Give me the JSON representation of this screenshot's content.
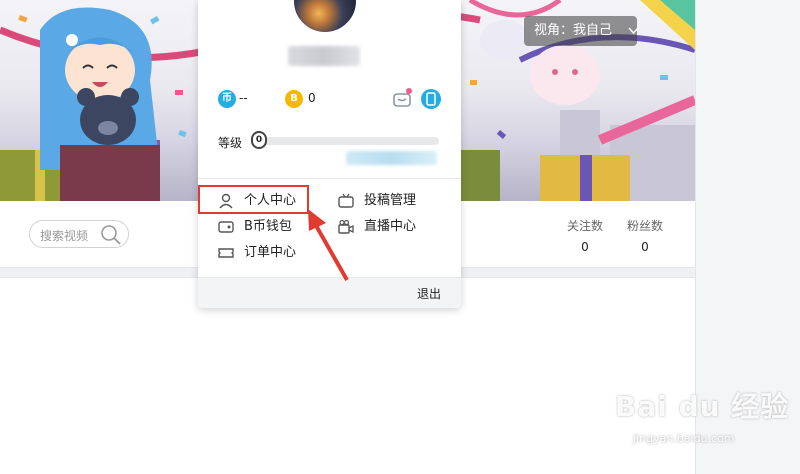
{
  "banner": {
    "view_label": "视角：我自己",
    "view_chevron_icon": "chevron-down-icon"
  },
  "profile": {
    "search_placeholder": "搜索视频",
    "following_label": "关注数",
    "following_count": "0",
    "fans_label": "粉丝数",
    "fans_count": "0"
  },
  "dropdown": {
    "coins_label": "币",
    "coins_value": "--",
    "bcoin_label": "B",
    "bcoin_value": "0",
    "level_label": "等级",
    "level_badge": "0",
    "level_progress": 0,
    "menu": [
      {
        "label": "个人中心",
        "icon": "person-icon"
      },
      {
        "label": "投稿管理",
        "icon": "tv-icon"
      },
      {
        "label": "B币钱包",
        "icon": "wallet-icon"
      },
      {
        "label": "直播中心",
        "icon": "video-camera-icon"
      },
      {
        "label": "订单中心",
        "icon": "ticket-icon"
      }
    ],
    "logout_label": "退出"
  },
  "watermark": {
    "brand": "Bai du 经验",
    "url": "jingyan.baidu.com"
  },
  "colors": {
    "highlight": "#e23a30",
    "coin_blue": "#23ade5",
    "coin_gold": "#f5b800",
    "accent_pink": "#f45a8d"
  }
}
